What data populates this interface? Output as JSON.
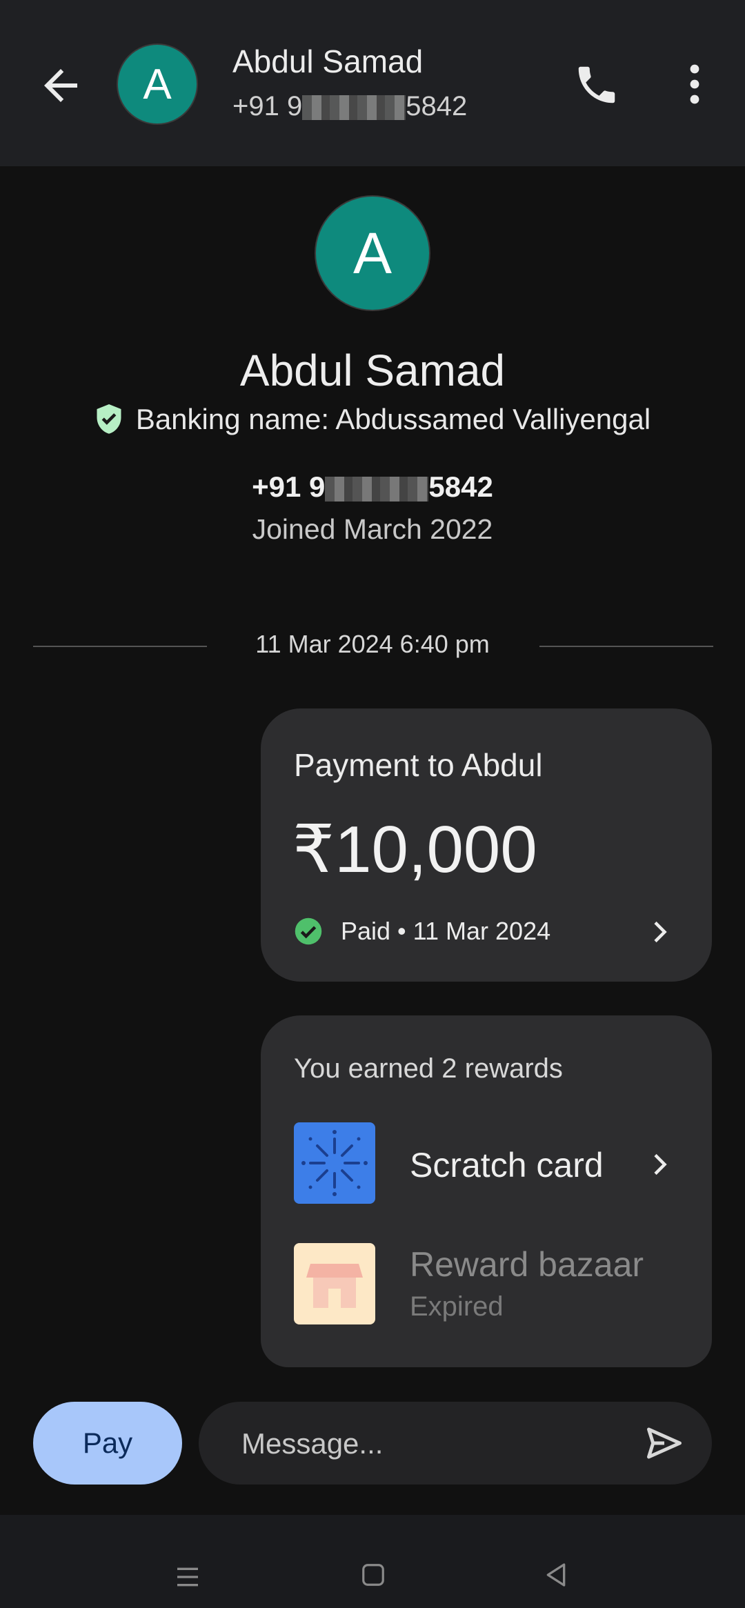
{
  "header": {
    "contact_name": "Abdul Samad",
    "phone_prefix": "+91 9",
    "phone_suffix": "5842",
    "avatar_letter": "A"
  },
  "profile": {
    "avatar_letter": "A",
    "name": "Abdul Samad",
    "banking_label": "Banking name: Abdussamed  Valliyengal",
    "phone_prefix": "+91 9",
    "phone_suffix": "5842",
    "joined": "Joined March 2022"
  },
  "timeline": {
    "timestamp": "11 Mar 2024 6:40 pm"
  },
  "payment": {
    "title": "Payment to Abdul",
    "amount": "₹10,000",
    "status": "Paid • 11 Mar 2024"
  },
  "rewards": {
    "title": "You earned 2 rewards",
    "items": [
      {
        "label": "Scratch card",
        "status": ""
      },
      {
        "label": "Reward bazaar",
        "status": "Expired"
      }
    ]
  },
  "composer": {
    "pay_label": "Pay",
    "placeholder": "Message..."
  },
  "icons": {
    "back": "arrow-back-icon",
    "call": "phone-icon",
    "more": "more-vert-icon",
    "verified": "shield-check-icon",
    "paid": "check-circle-icon",
    "send": "send-icon"
  },
  "colors": {
    "avatar": "#0e8a7d",
    "pay_button": "#a8c7fa",
    "paid_green": "#4fc06b",
    "scratch_card": "#3d7ee8",
    "bazaar_card": "#fde8c6"
  }
}
